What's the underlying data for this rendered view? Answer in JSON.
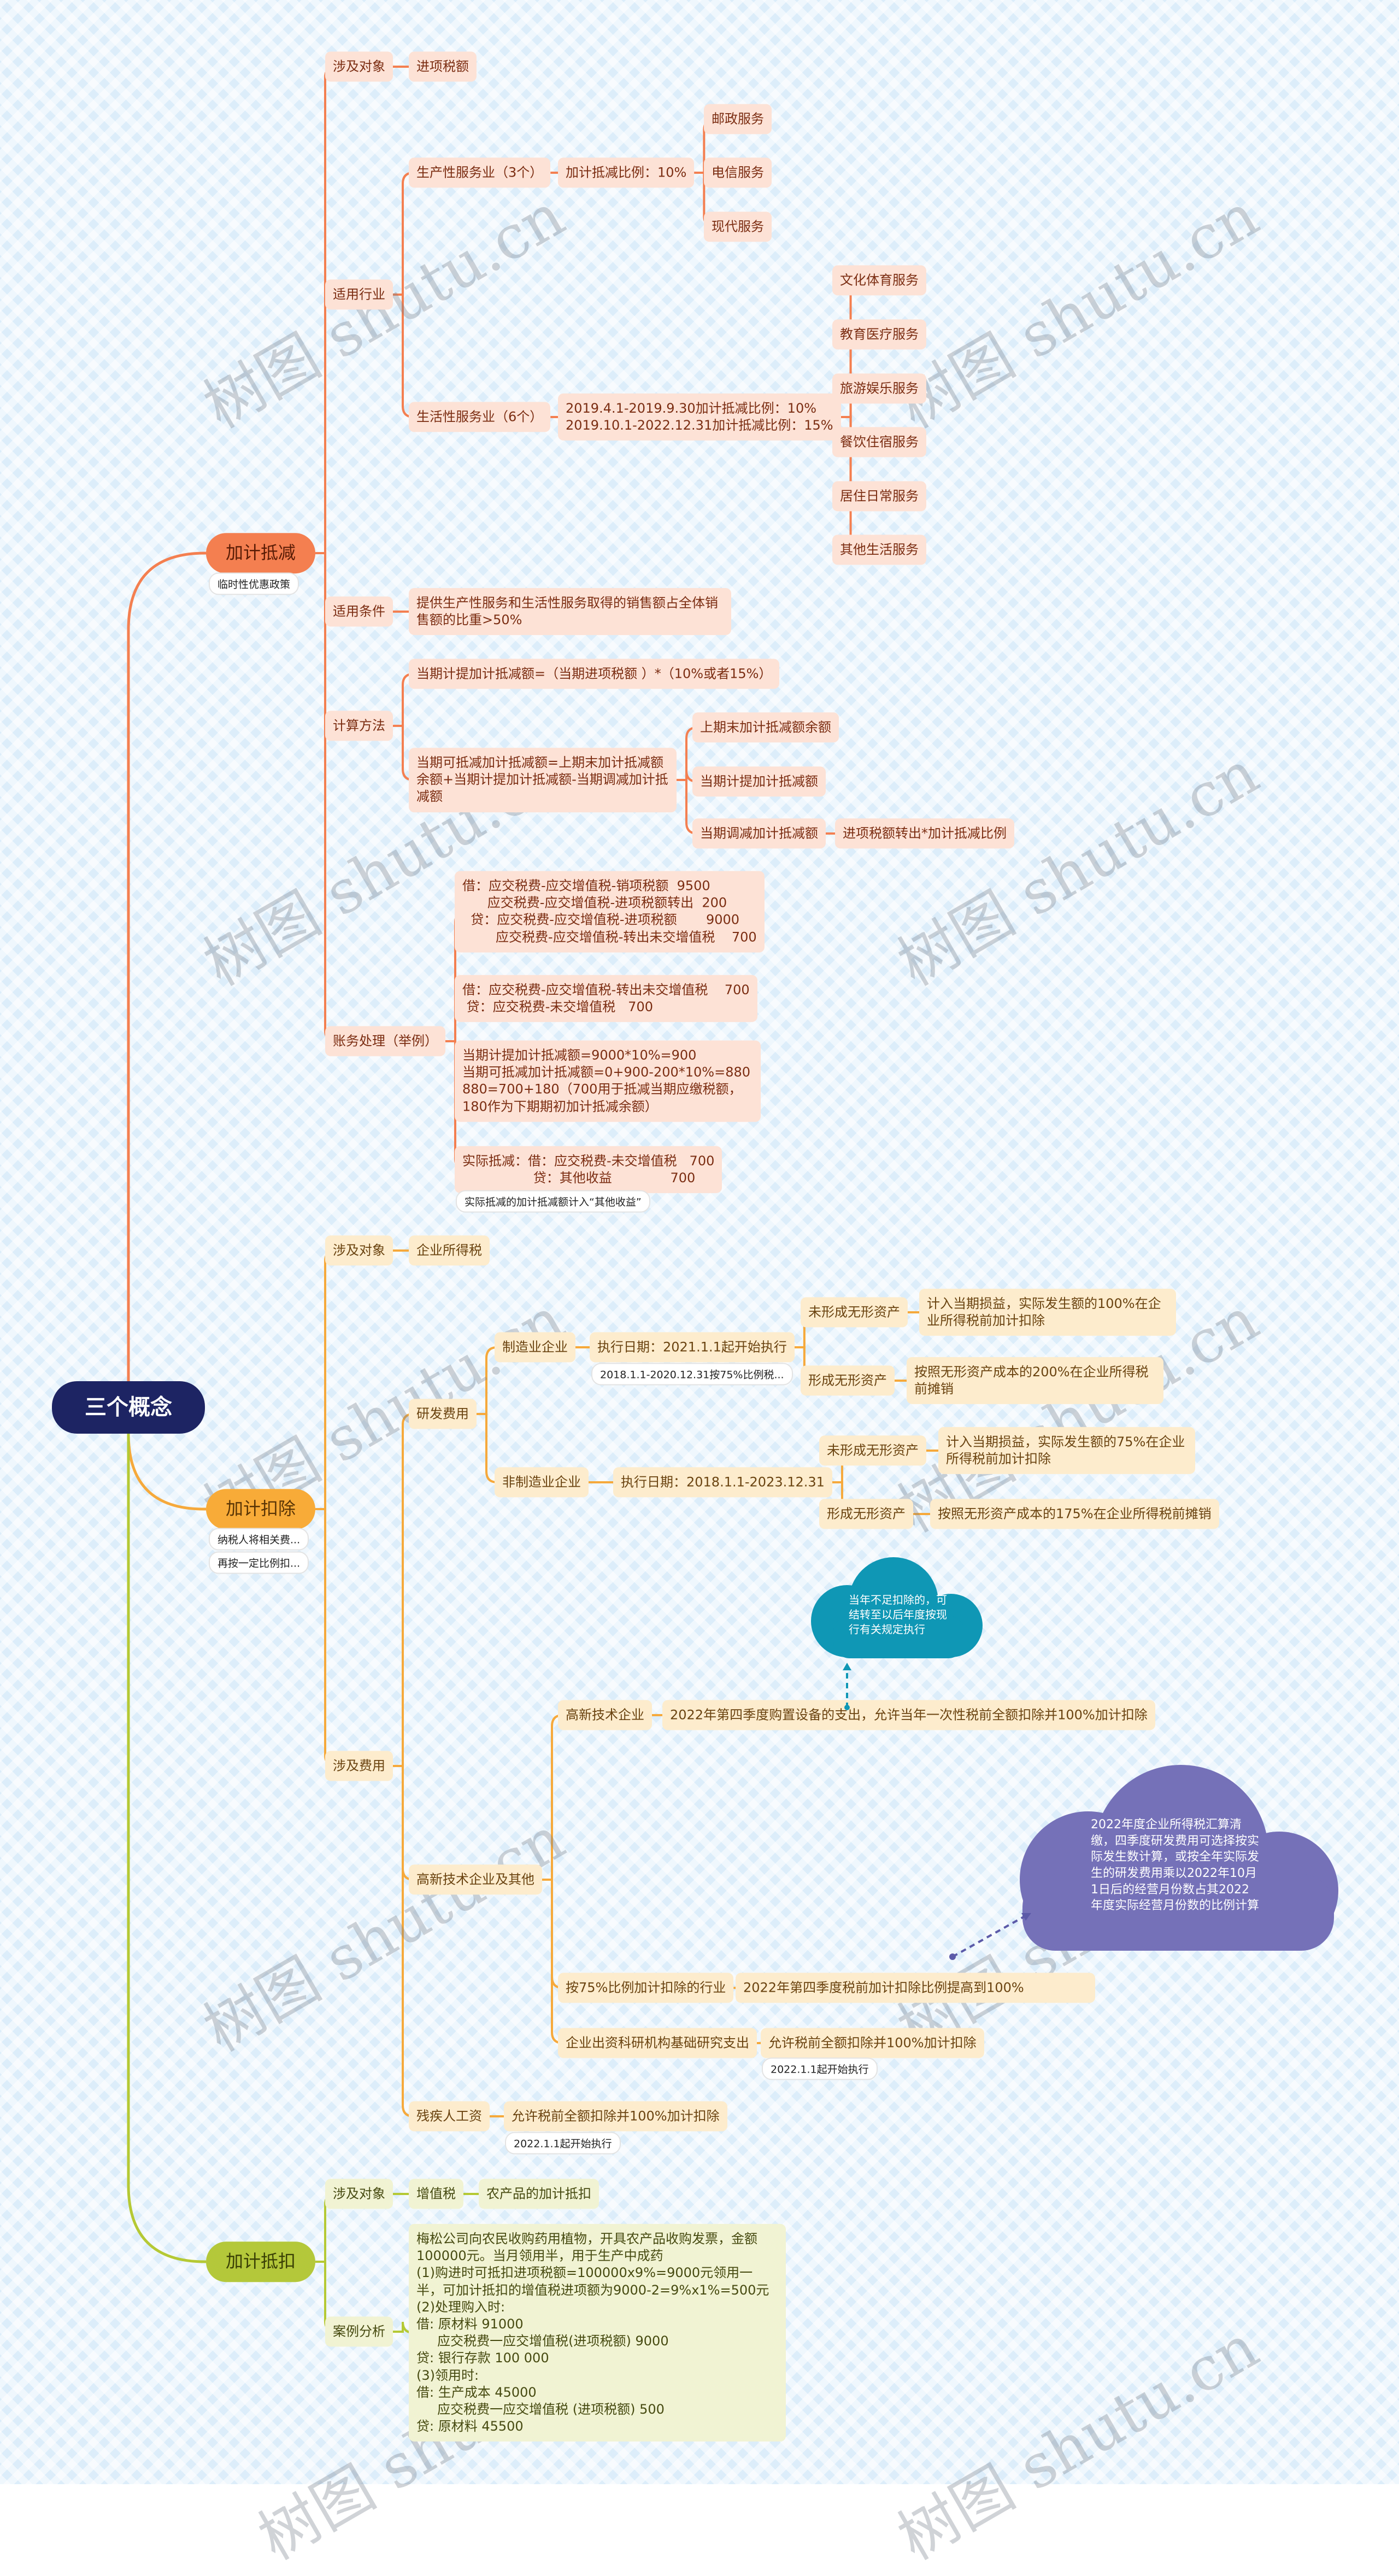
{
  "root": "三个概念",
  "watermark": "树图 shutu.cn",
  "colors": {
    "root": "#1d2463",
    "b1": "#f47f50",
    "b2": "#f8ab38",
    "b3": "#b4c83a",
    "cloud_teal": "#0f97b5",
    "cloud_purple": "#7671b8"
  },
  "b1": {
    "label": "加计抵减",
    "note": "临时性优惠政策",
    "object": {
      "label": "涉及对象",
      "value": "进项税额"
    },
    "industry": {
      "label": "适用行业",
      "production": {
        "label": "生产性服务业（3个）",
        "rate": "加计抵减比例：10%",
        "items": [
          "邮政服务",
          "电信服务",
          "现代服务"
        ]
      },
      "life": {
        "label": "生活性服务业（6个）",
        "rate": [
          "2019.4.1-2019.9.30加计抵减比例：10%",
          "2019.10.1-2022.12.31加计抵减比例：15%"
        ],
        "items": [
          "文化体育服务",
          "教育医疗服务",
          "旅游娱乐服务",
          "餐饮住宿服务",
          "居住日常服务",
          "其他生活服务"
        ]
      }
    },
    "condition": {
      "label": "适用条件",
      "value": "提供生产性服务和生活性服务取得的销售额占全体销售额的比重>50%"
    },
    "calc": {
      "label": "计算方法",
      "formula1": "当期计提加计抵减额=（当期进项税额 ）*（10%或者15%）",
      "formula2": "当期可抵减加计抵减额=上期末加计抵减额余额+当期计提加计抵减额-当期调减加计抵减额",
      "parts": [
        "上期末加计抵减额余额",
        "当期计提加计抵减额",
        "当期调减加计抵减额"
      ],
      "adjust_detail": "进项税额转出*加计抵减比例"
    },
    "accounting": {
      "label": "账务处理（举例）",
      "entry1": [
        "借：应交税费-应交增值税-销项税额  9500",
        "      应交税费-应交增值税-进项税额转出  200",
        "  贷：应交税费-应交增值税-进项税额       9000",
        "        应交税费-应交增值税-转出未交增值税    700"
      ],
      "entry2": [
        "借：应交税费-应交增值税-转出未交增值税    700",
        " 贷：应交税费-未交增值税   700"
      ],
      "entry3": [
        "当期计提加计抵减额=9000*10%=900",
        "当期可抵减加计抵减额=0+900-200*10%=880",
        "880=700+180（700用于抵减当期应缴税额，180作为下期期初加计抵减余额）"
      ],
      "entry4": [
        "实际抵减：借：应交税费-未交增值税   700",
        "                 贷：其他收益              700"
      ],
      "note": "实际抵减的加计抵减额计入“其他收益”"
    }
  },
  "b2": {
    "label": "加计扣除",
    "notes": [
      "纳税人将相关费...",
      "再按一定比例扣..."
    ],
    "object": {
      "label": "涉及对象",
      "value": "企业所得税"
    },
    "expense": {
      "label": "涉及费用",
      "rd": {
        "label": "研发费用",
        "mfg": {
          "label": "制造业企业",
          "date": "执行日期：2021.1.1起开始执行",
          "date_note": "2018.1.1-2020.12.31按75%比例税...",
          "no_asset": {
            "label": "未形成无形资产",
            "value": "计入当期损益，实际发生额的100%在企业所得税前加计扣除"
          },
          "asset": {
            "label": "形成无形资产",
            "value": "按照无形资产成本的200%在企业所得税前摊销"
          }
        },
        "nonmfg": {
          "label": "非制造业企业",
          "date": "执行日期：2018.1.1-2023.12.31",
          "no_asset": {
            "label": "未形成无形资产",
            "value": "计入当期损益，实际发生额的75%在企业所得税前加计扣除"
          },
          "asset": {
            "label": "形成无形资产",
            "value": "按照无形资产成本的175%在企业所得税前摊销"
          }
        }
      },
      "hightech": {
        "label": "高新技术企业及其他",
        "ht": {
          "label": "高新技术企业",
          "value": "2022年第四季度购置设备的支出，允许当年一次性税前全额扣除并100%加计扣除",
          "callout": "当年不足扣除的，可结转至以后年度按现行有关规定执行"
        },
        "pct75": {
          "label": "按75%比例加计扣除的行业",
          "value": "2022年第四季度税前加计扣除比例提高到100%",
          "callout": "2022年度企业所得税汇算清缴，四季度研发费用可选择按实际发生数计算，或按全年实际发生的研发费用乘以2022年10月1日后的经营月份数占其2022年度实际经营月份数的比例计算"
        },
        "research": {
          "label": "企业出资科研机构基础研究支出",
          "value": "允许税前全额扣除并100%加计扣除",
          "note": "2022.1.1起开始执行"
        }
      },
      "disabled": {
        "label": "残疾人工资",
        "value": "允许税前全额扣除并100%加计扣除",
        "note": "2022.1.1起开始执行"
      }
    }
  },
  "b3": {
    "label": "加计抵扣",
    "object": {
      "label": "涉及对象",
      "tax": "增值税",
      "value": "农产品的加计抵扣"
    },
    "case": {
      "label": "案例分析",
      "lines": [
        "梅松公司向农民收购药用植物，开具农产品收购发票，金额100000元。当月领用半，用于生产中成药",
        "(1)购进时可抵扣进项税额=100000x9%=9000元领用一半，可加计抵扣的增值税进项额为9000-2=9%x1%=500元",
        "(2)处理购入时:",
        "借: 原材料 91000",
        "     应交税费一应交增值税(进项税额) 9000",
        "贷: 银行存款 100 000",
        "(3)领用时:",
        "借: 生产成本 45000",
        "     应交税费一应交增值税 (进项税额) 500",
        "贷: 原材料 45500"
      ]
    }
  }
}
